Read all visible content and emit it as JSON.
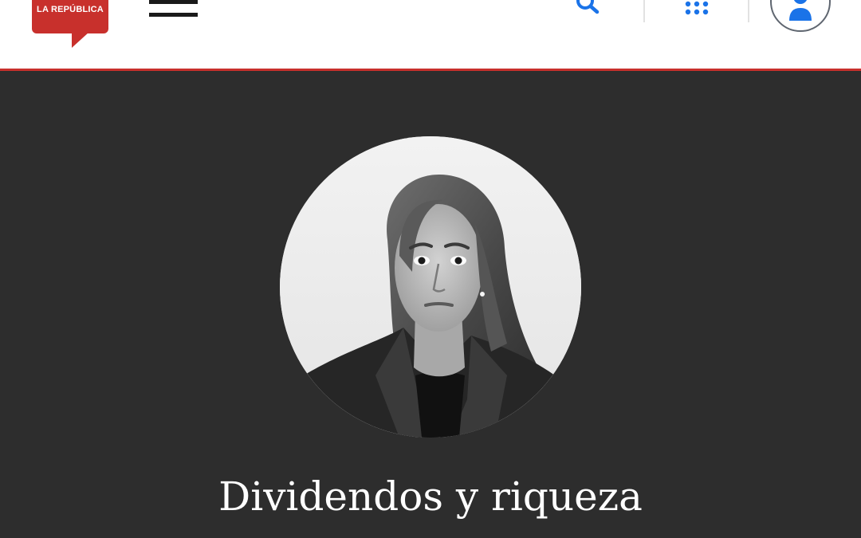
{
  "header": {
    "logo": {
      "brand_text": "LA REPÚBLICA",
      "brand_color": "#c8302c"
    },
    "menu_icon": "hamburger-menu-icon",
    "search_icon": "search-icon",
    "apps_icon": "apps-grid-icon",
    "account_icon": "user-account-icon",
    "accent_color": "#1a73e8",
    "underline_color": "#c8302c"
  },
  "article": {
    "author_photo": "author-portrait",
    "title": "Dividendos y riqueza",
    "background_color": "#2d2d2d"
  }
}
